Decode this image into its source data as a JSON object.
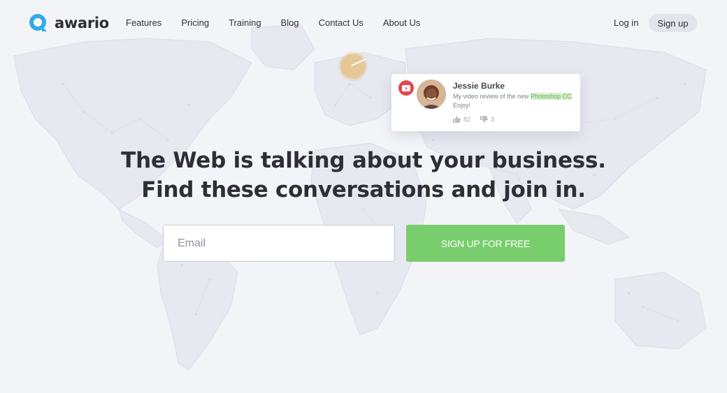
{
  "brand": {
    "name": "awario",
    "accent": "#33a9e8"
  },
  "nav": {
    "items": [
      {
        "label": "Features"
      },
      {
        "label": "Pricing"
      },
      {
        "label": "Training"
      },
      {
        "label": "Blog"
      },
      {
        "label": "Contact Us"
      },
      {
        "label": "About Us"
      }
    ],
    "login_label": "Log in",
    "signup_label": "Sign up"
  },
  "mention_card": {
    "source_icon": "youtube-icon",
    "author": "Jessie Burke",
    "text_before": "My video review of the new ",
    "highlight": "Photoshop CC",
    "text_after": ". Enjoy!",
    "likes": "82",
    "dislikes": "3"
  },
  "hero": {
    "line1": "The Web is talking about your business.",
    "line2": "Find these conversations and join in.",
    "email_placeholder": "Email",
    "cta_label": "SIGN UP FOR FREE",
    "cta_color": "#78cd6c"
  }
}
